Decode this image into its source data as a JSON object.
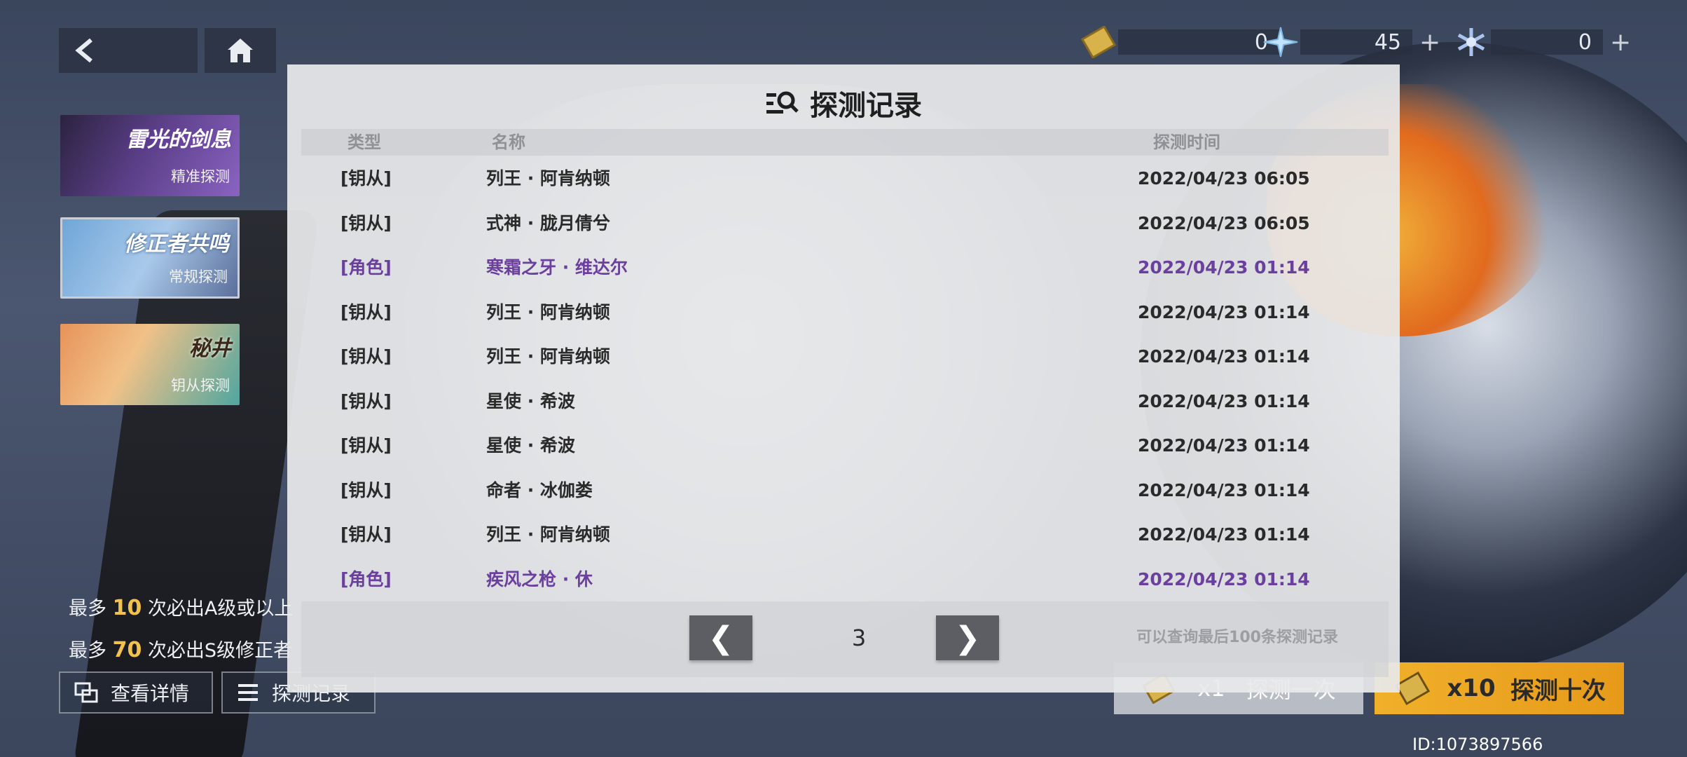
{
  "header": {
    "currencies": [
      {
        "icon": "gold-ticket-icon",
        "value": "0",
        "has_plus": false
      },
      {
        "icon": "crystal-star-icon",
        "value": "45",
        "has_plus": true
      },
      {
        "icon": "snowflake-crystal-icon",
        "value": "0",
        "has_plus": true
      }
    ]
  },
  "banners": [
    {
      "title": "雷光的剑息",
      "subtitle": "精准探测"
    },
    {
      "title": "修正者共鸣",
      "subtitle": "常规探测"
    },
    {
      "title": "秘井",
      "subtitle": "钥从探测"
    }
  ],
  "guarantees": [
    {
      "prefix": "最多",
      "num": "10",
      "suffix": "次必出A级或以上"
    },
    {
      "prefix": "最多",
      "num": "70",
      "suffix": "次必出S级修正者"
    }
  ],
  "bottom_buttons": {
    "details": "查看详情",
    "records": "探测记录"
  },
  "pull_buttons": {
    "single_count": "x1",
    "single_label": "探测一次",
    "ten_count": "x10",
    "ten_label": "探测十次"
  },
  "uid": "ID:1073897566",
  "modal": {
    "title": "探测记录",
    "columns": {
      "type": "类型",
      "name": "名称",
      "time": "探测时间"
    },
    "rows": [
      {
        "type": "[钥从]",
        "name": "列王 · 阿肯纳顿",
        "time": "2022/04/23 06:05",
        "highlight": false
      },
      {
        "type": "[钥从]",
        "name": "式神 · 胧月倩兮",
        "time": "2022/04/23 06:05",
        "highlight": false
      },
      {
        "type": "[角色]",
        "name": "寒霜之牙 · 维达尔",
        "time": "2022/04/23 01:14",
        "highlight": true
      },
      {
        "type": "[钥从]",
        "name": "列王 · 阿肯纳顿",
        "time": "2022/04/23 01:14",
        "highlight": false
      },
      {
        "type": "[钥从]",
        "name": "列王 · 阿肯纳顿",
        "time": "2022/04/23 01:14",
        "highlight": false
      },
      {
        "type": "[钥从]",
        "name": "星使 · 希波",
        "time": "2022/04/23 01:14",
        "highlight": false
      },
      {
        "type": "[钥从]",
        "name": "星使 · 希波",
        "time": "2022/04/23 01:14",
        "highlight": false
      },
      {
        "type": "[钥从]",
        "name": "命者 · 冰伽娄",
        "time": "2022/04/23 01:14",
        "highlight": false
      },
      {
        "type": "[钥从]",
        "name": "列王 · 阿肯纳顿",
        "time": "2022/04/23 01:14",
        "highlight": false
      },
      {
        "type": "[角色]",
        "name": "疾风之枪 · 休",
        "time": "2022/04/23 01:14",
        "highlight": true
      }
    ],
    "pager": {
      "prev": "❮",
      "page": "3",
      "next": "❯",
      "note": "可以查询最后100条探测记录"
    }
  },
  "colors": {
    "highlight": "#6b3f9e",
    "gold": "#f3c24a",
    "orange_button": "#f0b02a"
  }
}
